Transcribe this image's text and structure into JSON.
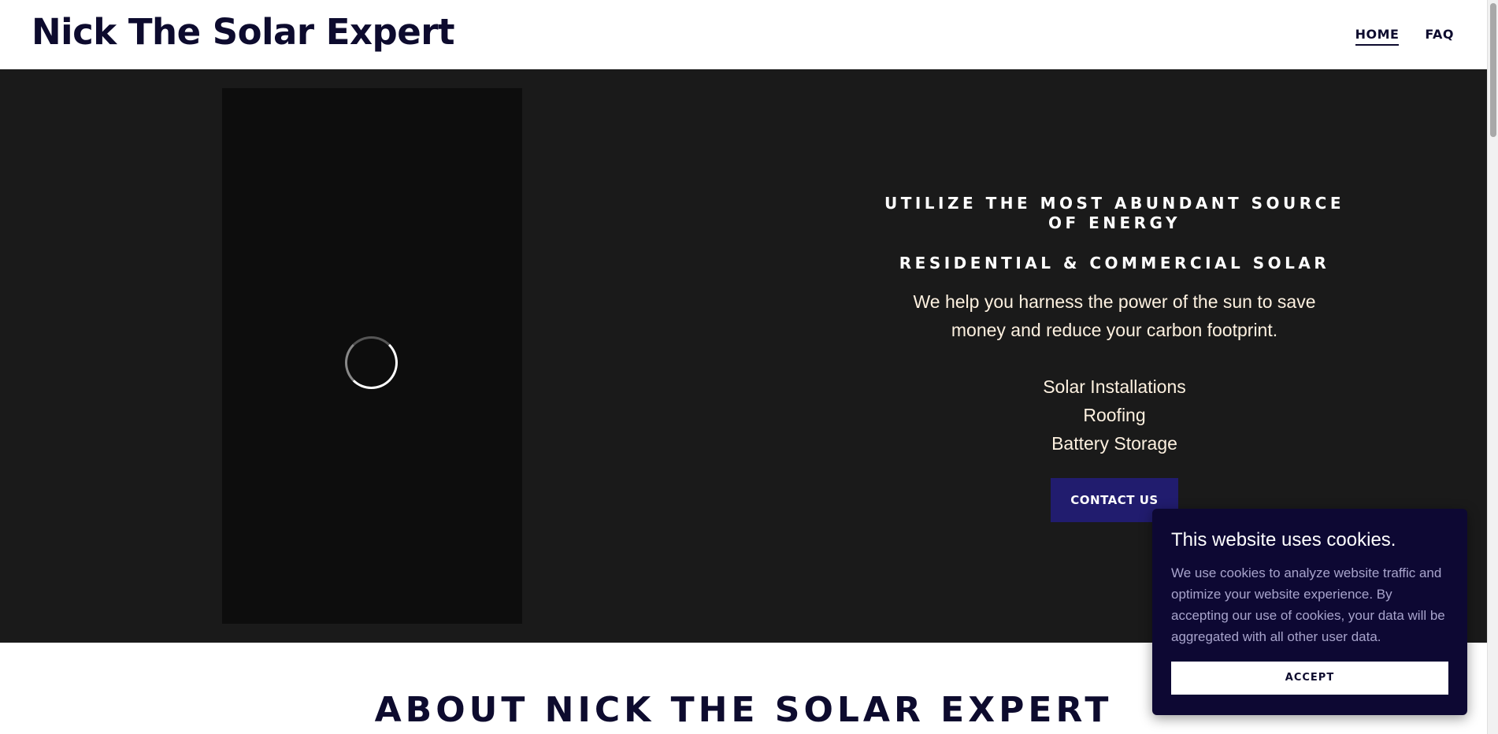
{
  "header": {
    "site_title": "Nick The Solar Expert",
    "nav": [
      {
        "label": "HOME",
        "active": true
      },
      {
        "label": "FAQ",
        "active": false
      }
    ]
  },
  "hero": {
    "heading": "Utilize the most abundant source of energy",
    "subheading": "Residential & Commercial Solar",
    "description": "We help you harness the power of the sun to save money and reduce your carbon footprint.",
    "services": [
      "Solar Installations",
      "Roofing",
      "Battery Storage"
    ],
    "cta_label": "CONTACT US",
    "video_state": "loading-spinner-icon"
  },
  "about": {
    "title": "ABOUT NICK THE SOLAR EXPERT"
  },
  "cookie_banner": {
    "title": "This website uses cookies.",
    "body": "We use cookies to analyze website traffic and optimize your website experience. By accepting our use of cookies, your data will be aggregated with all other user data.",
    "accept_label": "ACCEPT"
  },
  "colors": {
    "brand_dark": "#0d0b2e",
    "hero_bg": "#1a1a1a",
    "cta_bg": "#211c6e",
    "cookie_bg": "#0d0833",
    "hero_text": "#fdf1e0"
  }
}
